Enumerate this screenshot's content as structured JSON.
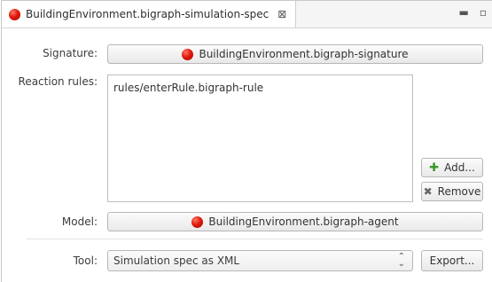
{
  "tab": {
    "title": "BuildingEnvironment.bigraph-simulation-spec",
    "close_glyph": "⊠"
  },
  "window_controls": {
    "minimize": "▬",
    "maximize": "▫"
  },
  "signature": {
    "label": "Signature:",
    "value": "BuildingEnvironment.bigraph-signature"
  },
  "reaction_rules": {
    "label": "Reaction rules:",
    "items": [
      "rules/enterRule.bigraph-rule"
    ]
  },
  "buttons": {
    "add_label": "Add...",
    "remove_label": "Remove",
    "export_label": "Export..."
  },
  "model": {
    "label": "Model:",
    "value": "BuildingEnvironment.bigraph-agent"
  },
  "tool": {
    "label": "Tool:",
    "selected": "Simulation spec as XML"
  },
  "icons": {
    "file_icon_color": "#e11a0c",
    "add_icon": "plus-icon",
    "remove_icon": "x-icon"
  }
}
